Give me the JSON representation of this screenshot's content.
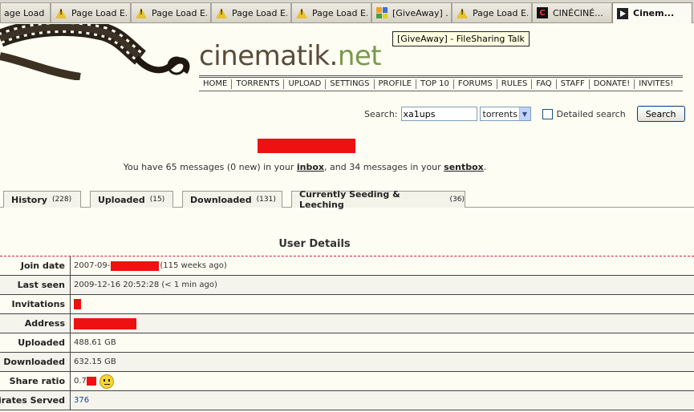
{
  "browser": {
    "tabs": [
      {
        "label": "age Load E...",
        "icon": "warning-icon"
      },
      {
        "label": "Page Load E...",
        "icon": "warning-icon"
      },
      {
        "label": "Page Load E...",
        "icon": "warning-icon"
      },
      {
        "label": "Page Load E...",
        "icon": "warning-icon"
      },
      {
        "label": "Page Load E...",
        "icon": "warning-icon"
      },
      {
        "label": "[GiveAway] ...",
        "icon": "filesharing-icon"
      },
      {
        "label": "Page Load E...",
        "icon": "warning-icon"
      },
      {
        "label": "CINÉCINÉ...",
        "icon": "cinecine-icon"
      },
      {
        "label": "Cinem...",
        "icon": "cinematik-icon"
      }
    ],
    "tooltip": "[GiveAway] - FileSharing Talk"
  },
  "header": {
    "logo_main": "cinematik",
    "logo_dot": ".",
    "logo_tld": "net",
    "nav": [
      "HOME",
      "TORRENTS",
      "UPLOAD",
      "SETTINGS",
      "PROFILE",
      "TOP 10",
      "FORUMS",
      "RULES",
      "FAQ",
      "STAFF",
      "DONATE!",
      "INVITES!"
    ]
  },
  "search": {
    "label": "Search:",
    "value": "xa1ups",
    "category": "torrents",
    "detailed_label": "Detailed search",
    "button": "Search"
  },
  "messages": {
    "prefix": "You have 65 messages (0 new) in your ",
    "inbox": "inbox",
    "middle": ", and 34 messages in your ",
    "sentbox": "sentbox",
    "suffix": "."
  },
  "profile_tabs": [
    {
      "label": "History",
      "count": "(228)"
    },
    {
      "label": "Uploaded",
      "count": "(15)"
    },
    {
      "label": "Downloaded",
      "count": "(131)"
    },
    {
      "label": "Currently Seeding & Leeching",
      "count": "(36)"
    }
  ],
  "details": {
    "title": "User Details",
    "rows": [
      {
        "label": "Join date",
        "value_a": "2007-09-",
        "value_b": "(115 weeks ago)"
      },
      {
        "label": "Last seen",
        "value_a": "2009-12-16 20:52:28 (< 1 min ago)"
      },
      {
        "label": "Invitations",
        "value_a": ""
      },
      {
        "label": "Address",
        "value_a": ""
      },
      {
        "label": "Uploaded",
        "value_a": "488.61 GB"
      },
      {
        "label": "Downloaded",
        "value_a": "632.15 GB"
      },
      {
        "label": "Share ratio",
        "value_a": "0.7"
      },
      {
        "label": "Pirates Served",
        "value_a": "376"
      }
    ]
  },
  "colors": {
    "redaction": "#ee1111",
    "logo_brown": "#5a4b3a",
    "logo_green": "#7a9a4a",
    "link_blue": "#1a3f9a"
  }
}
